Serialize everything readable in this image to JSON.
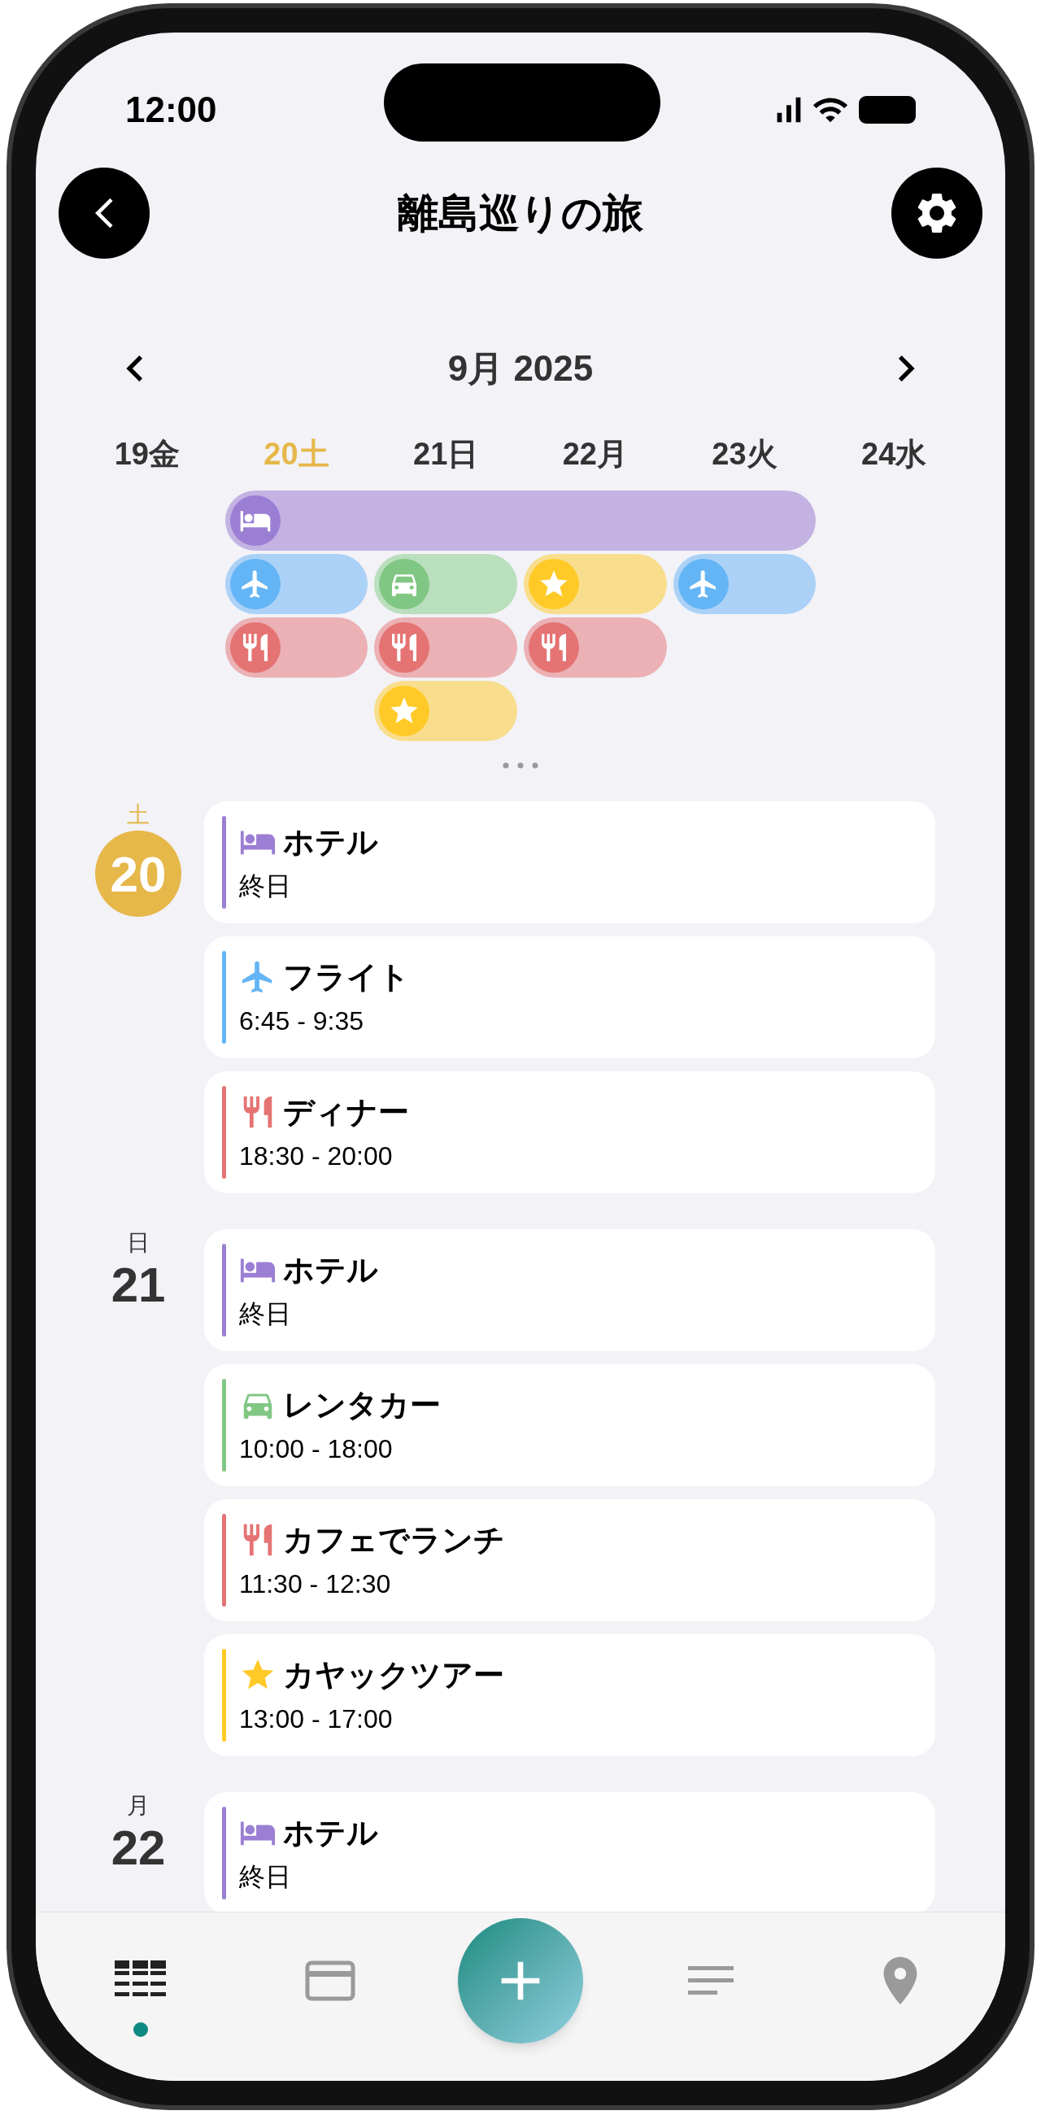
{
  "status_bar": {
    "time": "12:00"
  },
  "header": {
    "title": "離島巡りの旅"
  },
  "calendar": {
    "month": "9月 2025",
    "days": [
      {
        "label": "19金",
        "selected": false
      },
      {
        "label": "20土",
        "selected": true
      },
      {
        "label": "21日",
        "selected": false
      },
      {
        "label": "22月",
        "selected": false
      },
      {
        "label": "23火",
        "selected": false
      },
      {
        "label": "24水",
        "selected": false
      }
    ],
    "lanes": [
      {
        "cells": [
          {
            "kind": "none"
          },
          {
            "kind": "hotel"
          },
          {
            "kind": "continued"
          },
          {
            "kind": "continued"
          },
          {
            "kind": "continued"
          },
          {
            "kind": "none"
          }
        ]
      },
      {
        "cells": [
          {
            "kind": "none"
          },
          {
            "kind": "flight"
          },
          {
            "kind": "car"
          },
          {
            "kind": "activity"
          },
          {
            "kind": "flight"
          },
          {
            "kind": "none"
          }
        ]
      },
      {
        "cells": [
          {
            "kind": "none"
          },
          {
            "kind": "meal"
          },
          {
            "kind": "meal"
          },
          {
            "kind": "meal"
          },
          {
            "kind": "none"
          },
          {
            "kind": "none"
          }
        ]
      },
      {
        "cells": [
          {
            "kind": "none"
          },
          {
            "kind": "none"
          },
          {
            "kind": "activity"
          },
          {
            "kind": "none"
          },
          {
            "kind": "none"
          },
          {
            "kind": "none"
          }
        ]
      }
    ],
    "has_more": true
  },
  "agenda": [
    {
      "weekday": "土",
      "day": "20",
      "selected": true,
      "events": [
        {
          "kind": "hotel",
          "title": "ホテル",
          "time": "終日"
        },
        {
          "kind": "flight",
          "title": "フライト",
          "time": "6:45 - 9:35"
        },
        {
          "kind": "meal",
          "title": "ディナー",
          "time": "18:30 - 20:00"
        }
      ]
    },
    {
      "weekday": "日",
      "day": "21",
      "selected": false,
      "events": [
        {
          "kind": "hotel",
          "title": "ホテル",
          "time": "終日"
        },
        {
          "kind": "car",
          "title": "レンタカー",
          "time": "10:00 - 18:00"
        },
        {
          "kind": "meal",
          "title": "カフェでランチ",
          "time": "11:30 - 12:30"
        },
        {
          "kind": "activity",
          "title": "カヤックツアー",
          "time": "13:00 - 17:00"
        }
      ]
    },
    {
      "weekday": "月",
      "day": "22",
      "selected": false,
      "events": [
        {
          "kind": "hotel",
          "title": "ホテル",
          "time": "終日"
        }
      ]
    }
  ],
  "nav": {
    "items": [
      {
        "kind": "schedule",
        "selected": true
      },
      {
        "kind": "expenses",
        "selected": false
      },
      {
        "kind": "add",
        "selected": false
      },
      {
        "kind": "notes",
        "selected": false
      },
      {
        "kind": "map",
        "selected": false
      }
    ]
  }
}
